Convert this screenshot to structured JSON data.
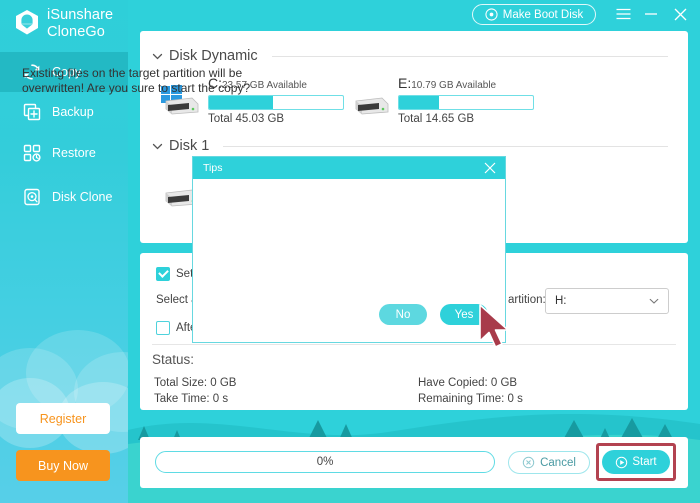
{
  "app": {
    "brand_line1": "iSunshare",
    "brand_line2": "CloneGo",
    "logo_icon": "shield-logo-icon"
  },
  "titlebar": {
    "make_boot_disk": "Make Boot Disk",
    "boot_disk_icon": "disc-icon",
    "menu_icon": "hamburger-menu-icon",
    "minimize_icon": "minimize-icon",
    "close_icon": "close-icon"
  },
  "sidebar": {
    "items": [
      {
        "label": "Copy",
        "icon": "refresh-copy-icon",
        "active": true
      },
      {
        "label": "Backup",
        "icon": "backup-plus-icon",
        "active": false
      },
      {
        "label": "Restore",
        "icon": "restore-grid-icon",
        "active": false
      },
      {
        "label": "Disk Clone",
        "icon": "disk-clone-icon",
        "active": false
      }
    ],
    "register_label": "Register",
    "buy_label": "Buy Now",
    "accent_orange": "#f7941e",
    "accent_teal": "#2ed1da"
  },
  "main": {
    "sections": [
      {
        "title": "Disk Dynamic",
        "chevron": "chevron-down-icon"
      },
      {
        "title": "Disk 1",
        "chevron": "chevron-down-icon"
      }
    ],
    "drives": [
      {
        "letter": "C:",
        "available": "23.57 GB Available",
        "total": "Total 45.03 GB",
        "fill_percent": 48,
        "icon": "windows-drive-icon"
      },
      {
        "letter": "E:",
        "available": "10.79 GB Available",
        "total": "Total 14.65 GB",
        "fill_percent": 30,
        "icon": "drive-icon"
      }
    ],
    "disk1_drive_icon": "drive-icon",
    "options": {
      "set_target_label": "Set t",
      "set_target_checked": true,
      "select_label": "Select a",
      "partition_label": "artition:",
      "partition_value": "H:",
      "partition_chevron": "chevron-down-icon",
      "after_label": "After",
      "after_checked": false
    },
    "status": {
      "heading": "Status:",
      "total_size": "Total Size: 0 GB",
      "have_copied": "Have Copied: 0 GB",
      "take_time": "Take Time: 0 s",
      "remaining_time": "Remaining Time: 0 s"
    }
  },
  "bottombar": {
    "progress_text": "0%",
    "progress_percent": 0,
    "cancel_label": "Cancel",
    "cancel_icon": "cancel-circle-icon",
    "start_label": "Start",
    "start_icon": "play-circle-icon",
    "start_highlight_color": "#b34250"
  },
  "dialog": {
    "title": "Tips",
    "close_icon": "close-icon",
    "message": "Existing files on the target partition will be overwritten! Are you sure to start the copy?",
    "no_label": "No",
    "yes_label": "Yes"
  },
  "cursor": {
    "icon": "mouse-pointer-icon",
    "color": "#a83b4a"
  }
}
